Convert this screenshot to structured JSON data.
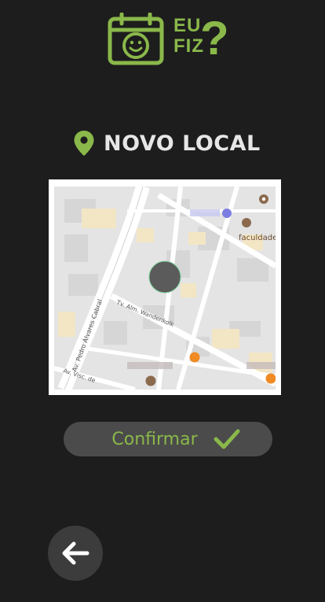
{
  "logo": {
    "line1": "EU",
    "line2": "FIZ",
    "mark": "?",
    "icon": "calendar-smiley-icon"
  },
  "header": {
    "title": "NOVO LOCAL",
    "icon": "location-pin-icon"
  },
  "map": {
    "labels": {
      "street1": "Av. Pedro Álvares Cabral",
      "street2": "Tv. Alm. Wandenkolk",
      "street3": "Av. Visc. de",
      "poi": "faculdade"
    }
  },
  "confirm": {
    "label": "Confirmar",
    "icon": "checkmark-icon"
  },
  "back": {
    "icon": "arrow-left-icon"
  },
  "colors": {
    "accent": "#8ab84a",
    "background": "#1d1d1d",
    "button": "#4b4b4b"
  }
}
